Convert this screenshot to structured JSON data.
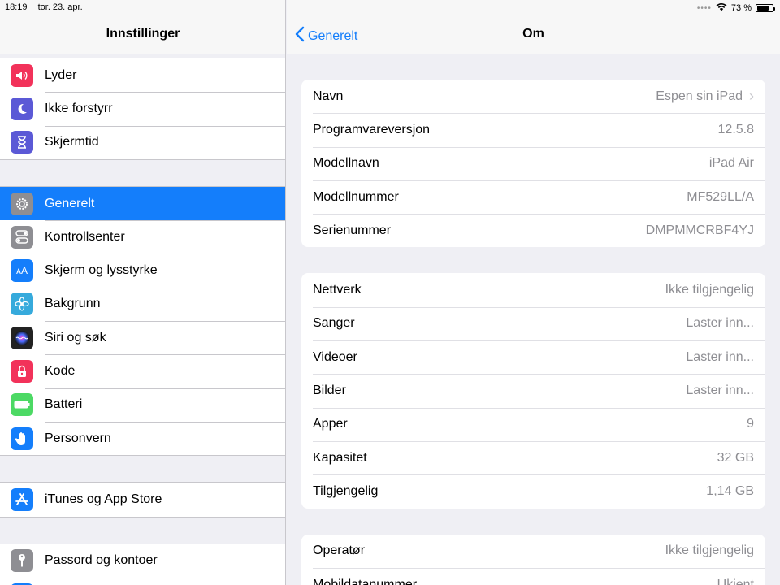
{
  "status": {
    "time": "18:19",
    "date": "tor. 23. apr.",
    "battery": "73 %"
  },
  "sidebar": {
    "title": "Innstillinger",
    "groups": [
      [
        {
          "label": "Lyder",
          "icon": "speaker-icon",
          "color": "#f2325a"
        },
        {
          "label": "Ikke forstyrr",
          "icon": "moon-icon",
          "color": "#5b59d6"
        },
        {
          "label": "Skjermtid",
          "icon": "hourglass-icon",
          "color": "#5b59d6"
        }
      ],
      [
        {
          "label": "Generelt",
          "icon": "gear-icon",
          "color": "#8e8e93",
          "selected": true
        },
        {
          "label": "Kontrollsenter",
          "icon": "toggles-icon",
          "color": "#8e8e93"
        },
        {
          "label": "Skjerm og lysstyrke",
          "icon": "text-size-icon",
          "color": "#147efb"
        },
        {
          "label": "Bakgrunn",
          "icon": "flower-icon",
          "color": "#36aadc"
        },
        {
          "label": "Siri og søk",
          "icon": "siri-icon",
          "color": "#222"
        },
        {
          "label": "Kode",
          "icon": "lock-icon",
          "color": "#f2325a"
        },
        {
          "label": "Batteri",
          "icon": "battery-icon",
          "color": "#4cd964"
        },
        {
          "label": "Personvern",
          "icon": "hand-icon",
          "color": "#147efb"
        }
      ],
      [
        {
          "label": "iTunes og App Store",
          "icon": "app-store-icon",
          "color": "#147efb"
        }
      ],
      [
        {
          "label": "Passord og kontoer",
          "icon": "key-icon",
          "color": "#8e8e93"
        }
      ]
    ]
  },
  "detail": {
    "back_label": "Generelt",
    "title": "Om",
    "sections": [
      [
        {
          "key": "Navn",
          "value": "Espen sin iPad",
          "chevron": true
        },
        {
          "key": "Programvareversjon",
          "value": "12.5.8"
        },
        {
          "key": "Modellnavn",
          "value": "iPad Air"
        },
        {
          "key": "Modellnummer",
          "value": "MF529LL/A"
        },
        {
          "key": "Serienummer",
          "value": "DMPMMCRBF4YJ"
        }
      ],
      [
        {
          "key": "Nettverk",
          "value": "Ikke tilgjengelig"
        },
        {
          "key": "Sanger",
          "value": "Laster inn..."
        },
        {
          "key": "Videoer",
          "value": "Laster inn..."
        },
        {
          "key": "Bilder",
          "value": "Laster inn..."
        },
        {
          "key": "Apper",
          "value": "9"
        },
        {
          "key": "Kapasitet",
          "value": "32 GB"
        },
        {
          "key": "Tilgjengelig",
          "value": "1,14 GB"
        }
      ],
      [
        {
          "key": "Operatør",
          "value": "Ikke tilgjengelig"
        },
        {
          "key": "Mobildatanummer",
          "value": "Ukjent"
        }
      ]
    ]
  }
}
